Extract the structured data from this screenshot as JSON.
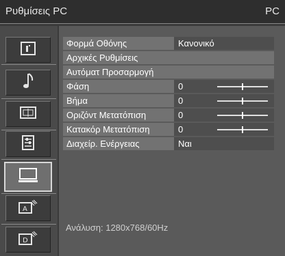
{
  "window": {
    "title": "Ρυθμίσεις PC",
    "source": "PC"
  },
  "sidebar": {
    "items": [
      {
        "icon": "picture-icon",
        "selected": false
      },
      {
        "icon": "music-note-icon",
        "selected": false
      },
      {
        "icon": "screen-format-icon",
        "selected": false
      },
      {
        "icon": "list-settings-icon",
        "selected": false
      },
      {
        "icon": "monitor-icon",
        "selected": true
      },
      {
        "icon": "input-a-icon",
        "selected": false
      },
      {
        "icon": "input-d-icon",
        "selected": false
      }
    ]
  },
  "menu": {
    "rows": [
      {
        "label": "Φορμά Οθόνης",
        "value": "Κανονικό",
        "type": "value"
      },
      {
        "label": "Αρχικές Ρυθμίσεις",
        "value": "",
        "type": "action"
      },
      {
        "label": "Αυτόματ Προσαρμογή",
        "value": "",
        "type": "action"
      },
      {
        "label": "Φάση",
        "value": "0",
        "type": "slider",
        "level": 0.5
      },
      {
        "label": "Βήμα",
        "value": "0",
        "type": "slider",
        "level": 0.5
      },
      {
        "label": "Οριζόντ Μετατόπιση",
        "value": "0",
        "type": "slider",
        "level": 0.5
      },
      {
        "label": "Κατακόρ Μετατόπιση",
        "value": "0",
        "type": "slider",
        "level": 0.5
      },
      {
        "label": "Διαχείρ. Ενέργειας",
        "value": "Ναι",
        "type": "value"
      }
    ]
  },
  "status": {
    "resolution": "Ανάλυση: 1280x768/60Hz"
  },
  "colors": {
    "background": "#5a5a5a",
    "row_highlight": "#727272",
    "titlebar": "#2e2e2e"
  }
}
